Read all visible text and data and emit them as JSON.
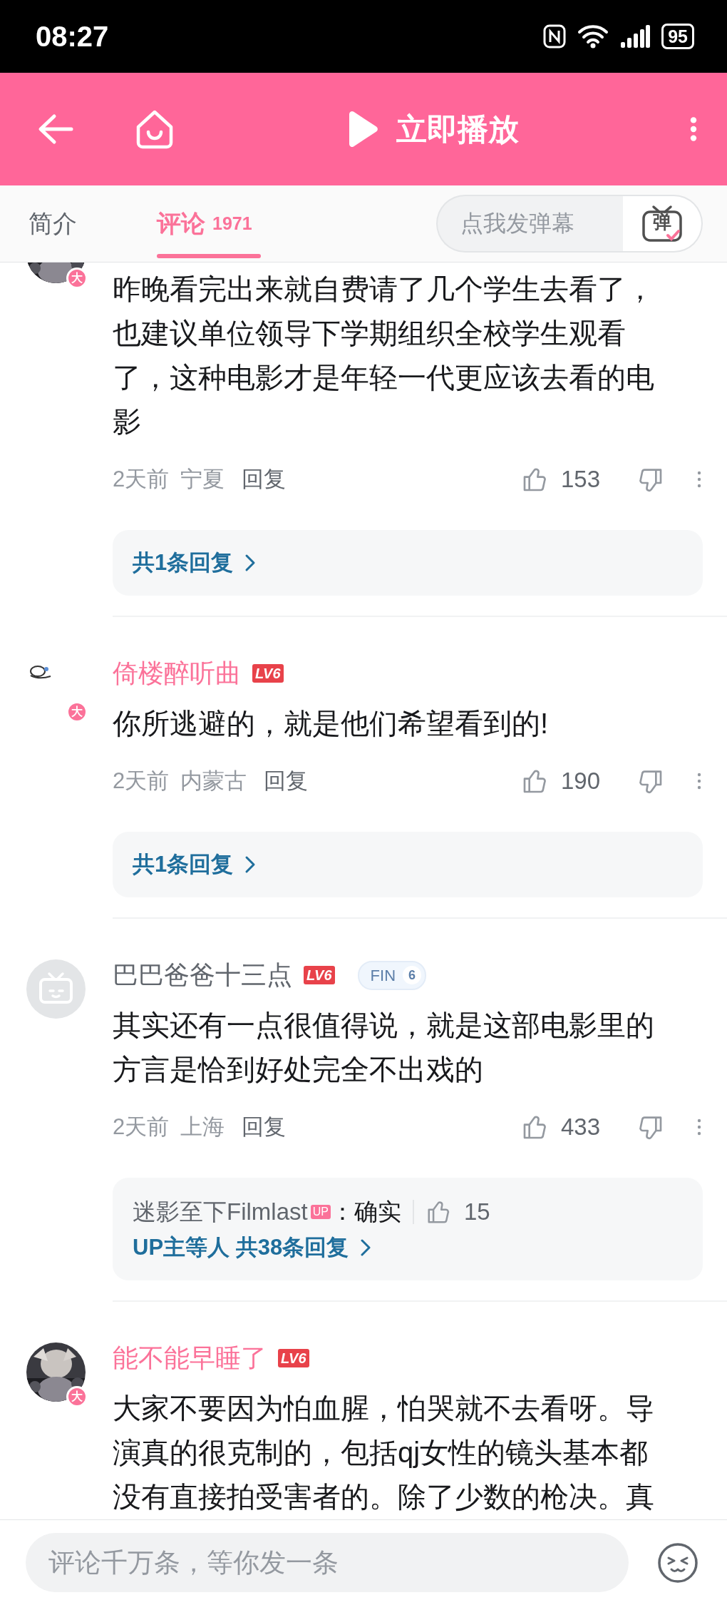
{
  "status_bar": {
    "time": "08:27",
    "battery": "95"
  },
  "header": {
    "play_label": "立即播放"
  },
  "tabs": [
    {
      "label": "简介",
      "selected": false
    },
    {
      "label": "评论",
      "count": "1971",
      "selected": true
    }
  ],
  "danmaku": {
    "placeholder": "点我发弹幕",
    "button": "弹"
  },
  "comments": [
    {
      "vip": true,
      "vip_badge": "大",
      "text": "昨晚看完出来就自费请了几个学生去看了，也建议单位领导下学期组织全校学生观看了，这种电影才是年轻一代更应该去看的电影",
      "time": "2天前",
      "location": "宁夏",
      "reply": "回复",
      "likes": "153",
      "replies": {
        "summary": "共1条回复"
      }
    },
    {
      "avatar": {
        "kind": "doodle"
      },
      "vip": true,
      "vip_badge": "大",
      "name": "倚楼醉听曲",
      "user_level": "LV6",
      "text": "你所逃避的，就是他们希望看到的!",
      "time": "2天前",
      "location": "内蒙古",
      "reply": "回复",
      "likes": "190",
      "replies": {
        "summary": "共1条回复"
      }
    },
    {
      "avatar": {
        "kind": "default"
      },
      "vip": false,
      "name": "巴巴爸爸十三点",
      "user_level": "LV6",
      "medal": {
        "label": "FIN",
        "rank": "6"
      },
      "text": "其实还有一点很值得说，就是这部电影里的方言是恰到好处完全不出戏的",
      "time": "2天前",
      "location": "上海",
      "reply": "回复",
      "likes": "433",
      "replies": {
        "preview": {
          "user": "迷影至下Filmlast",
          "tag": "UP",
          "text": "：确实",
          "likes": "15"
        },
        "summary": "UP主等人 共38条回复"
      }
    },
    {
      "vip": true,
      "vip_badge": "大",
      "name": "能不能早睡了",
      "user_level": "LV6",
      "text": "大家不要因为怕血腥，怕哭就不去看呀。导演真的很克制的，包括qj女性的镜头基本都没有直接拍受害者的。除了少数的枪决。真"
    }
  ],
  "bottom_bar": {
    "placeholder": "评论千万条，等你发一条"
  }
}
